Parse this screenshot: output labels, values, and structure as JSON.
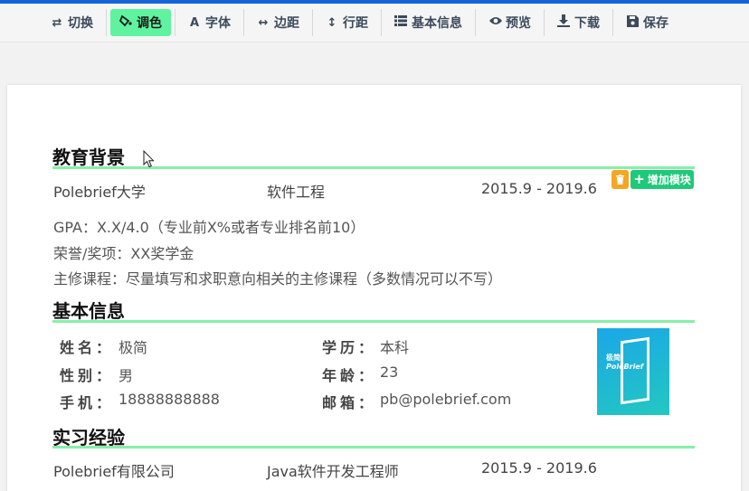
{
  "toolbar": {
    "items": [
      {
        "label": "切换",
        "icon": "swap-icon",
        "active": false
      },
      {
        "label": "调色",
        "icon": "paint-bucket-icon",
        "active": true
      },
      {
        "label": "字体",
        "icon": "font-icon",
        "active": false
      },
      {
        "label": "边距",
        "icon": "horizontal-arrows-icon",
        "active": false
      },
      {
        "label": "行距",
        "icon": "vertical-arrows-icon",
        "active": false
      },
      {
        "label": "基本信息",
        "icon": "grid-list-icon",
        "active": false
      },
      {
        "label": "预览",
        "icon": "eye-icon",
        "active": false
      },
      {
        "label": "下载",
        "icon": "download-icon",
        "active": false
      },
      {
        "label": "保存",
        "icon": "floppy-disk-icon",
        "active": false
      }
    ]
  },
  "colors": {
    "brand_bar": "#1565d8",
    "active_tab": "#5ff3a0",
    "rule": "#86f0a7",
    "add_button": "#1ec97a",
    "trash_button": "#f5a623"
  },
  "education": {
    "title": "教育背景",
    "school": "Polebrief大学",
    "major": "软件工程",
    "period": "2015.9 - 2019.6",
    "gpa": "GPA：X.X/4.0（专业前X%或者专业排名前10）",
    "honors": "荣誉/奖项：XX奖学金",
    "courses": "主修课程：尽量填写和求职意向相关的主修课程（多数情况可以不写）",
    "add_module_label": "增加模块"
  },
  "basic_info": {
    "title": "基本信息",
    "name_label": "姓名：",
    "name_value": "极简",
    "degree_label": "学历：",
    "degree_value": "本科",
    "gender_label": "性别：",
    "gender_value": "男",
    "age_label": "年龄：",
    "age_value": "23",
    "phone_label": "手机：",
    "phone_value": "18888888888",
    "email_label": "邮箱：",
    "email_value": "pb@polebrief.com",
    "photo_text_1": "极简",
    "photo_text_2": "PoleBrief"
  },
  "internship": {
    "title": "实习经验",
    "company": "Polebrief有限公司",
    "position": "Java软件开发工程师",
    "period": "2015.9 - 2019.6"
  }
}
